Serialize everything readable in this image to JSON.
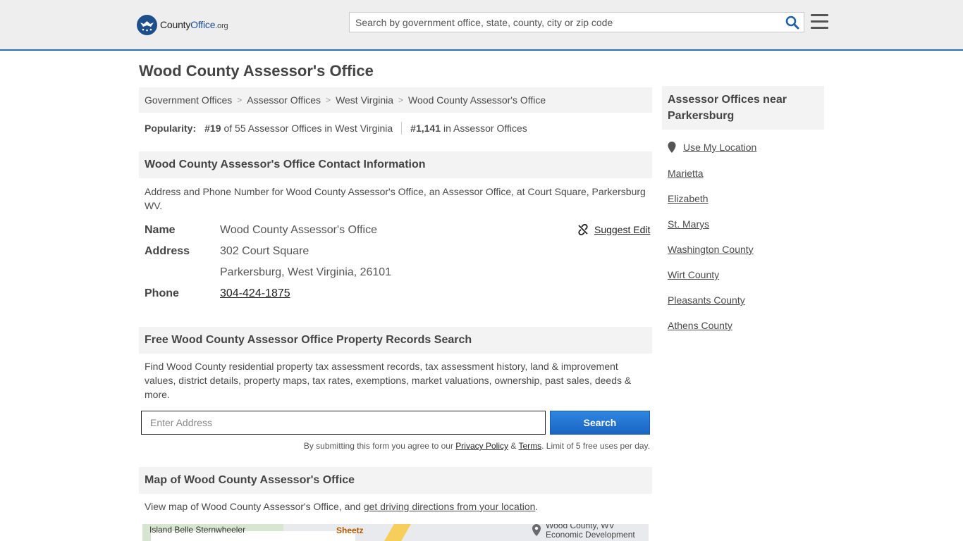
{
  "header": {
    "logo_main": "County",
    "logo_brand": "Office",
    "logo_tld": ".org",
    "search_placeholder": "Search by government office, state, county, city or zip code"
  },
  "page": {
    "title": "Wood County Assessor's Office"
  },
  "breadcrumb": [
    "Government Offices",
    "Assessor Offices",
    "West Virginia",
    "Wood County Assessor's Office"
  ],
  "popularity": {
    "label": "Popularity:",
    "state_rank": "#19",
    "state_text": "of 55 Assessor Offices in West Virginia",
    "national_rank": "#1,141",
    "national_text": "in Assessor Offices"
  },
  "contact": {
    "heading": "Wood County Assessor's Office Contact Information",
    "description": "Address and Phone Number for Wood County Assessor's Office, an Assessor Office, at Court Square, Parkersburg WV.",
    "name_label": "Name",
    "name_value": "Wood County Assessor's Office",
    "address_label": "Address",
    "address_line1": "302 Court Square",
    "address_line2": "Parkersburg, West Virginia, 26101",
    "phone_label": "Phone",
    "phone_value": "304-424-1875",
    "suggest_edit": "Suggest Edit"
  },
  "records": {
    "heading": "Free Wood County Assessor Office Property Records Search",
    "description": "Find Wood County residential property tax assessment records, tax assessment history, land & improvement values, district details, property maps, tax rates, exemptions, market valuations, ownership, past sales, deeds & more.",
    "input_placeholder": "Enter Address",
    "button_label": "Search",
    "disclaimer_prefix": "By submitting this form you agree to our",
    "privacy_link": "Privacy Policy",
    "amp": "&",
    "terms_link": "Terms",
    "disclaimer_suffix": ". Limit of 5 free uses per day."
  },
  "map": {
    "heading": "Map of Wood County Assessor's Office",
    "description_prefix": "View map of Wood County Assessor's Office, and",
    "directions_link": "get driving directions from your location",
    "description_suffix": ".",
    "label_left": "Island Belle Sternwheeler",
    "label_mid": "Sheetz",
    "label_right_1": "Wood County, WV",
    "label_right_2": "Economic Development"
  },
  "sidebar": {
    "heading": "Assessor Offices near Parkersburg",
    "use_location": "Use My Location",
    "links": [
      "Marietta",
      "Elizabeth",
      "St. Marys",
      "Washington County",
      "Wirt County",
      "Pleasants County",
      "Athens County"
    ]
  },
  "colors": {
    "accent": "#2a6fb8",
    "button": "#1a64c2",
    "panel": "#f3f3f3"
  }
}
